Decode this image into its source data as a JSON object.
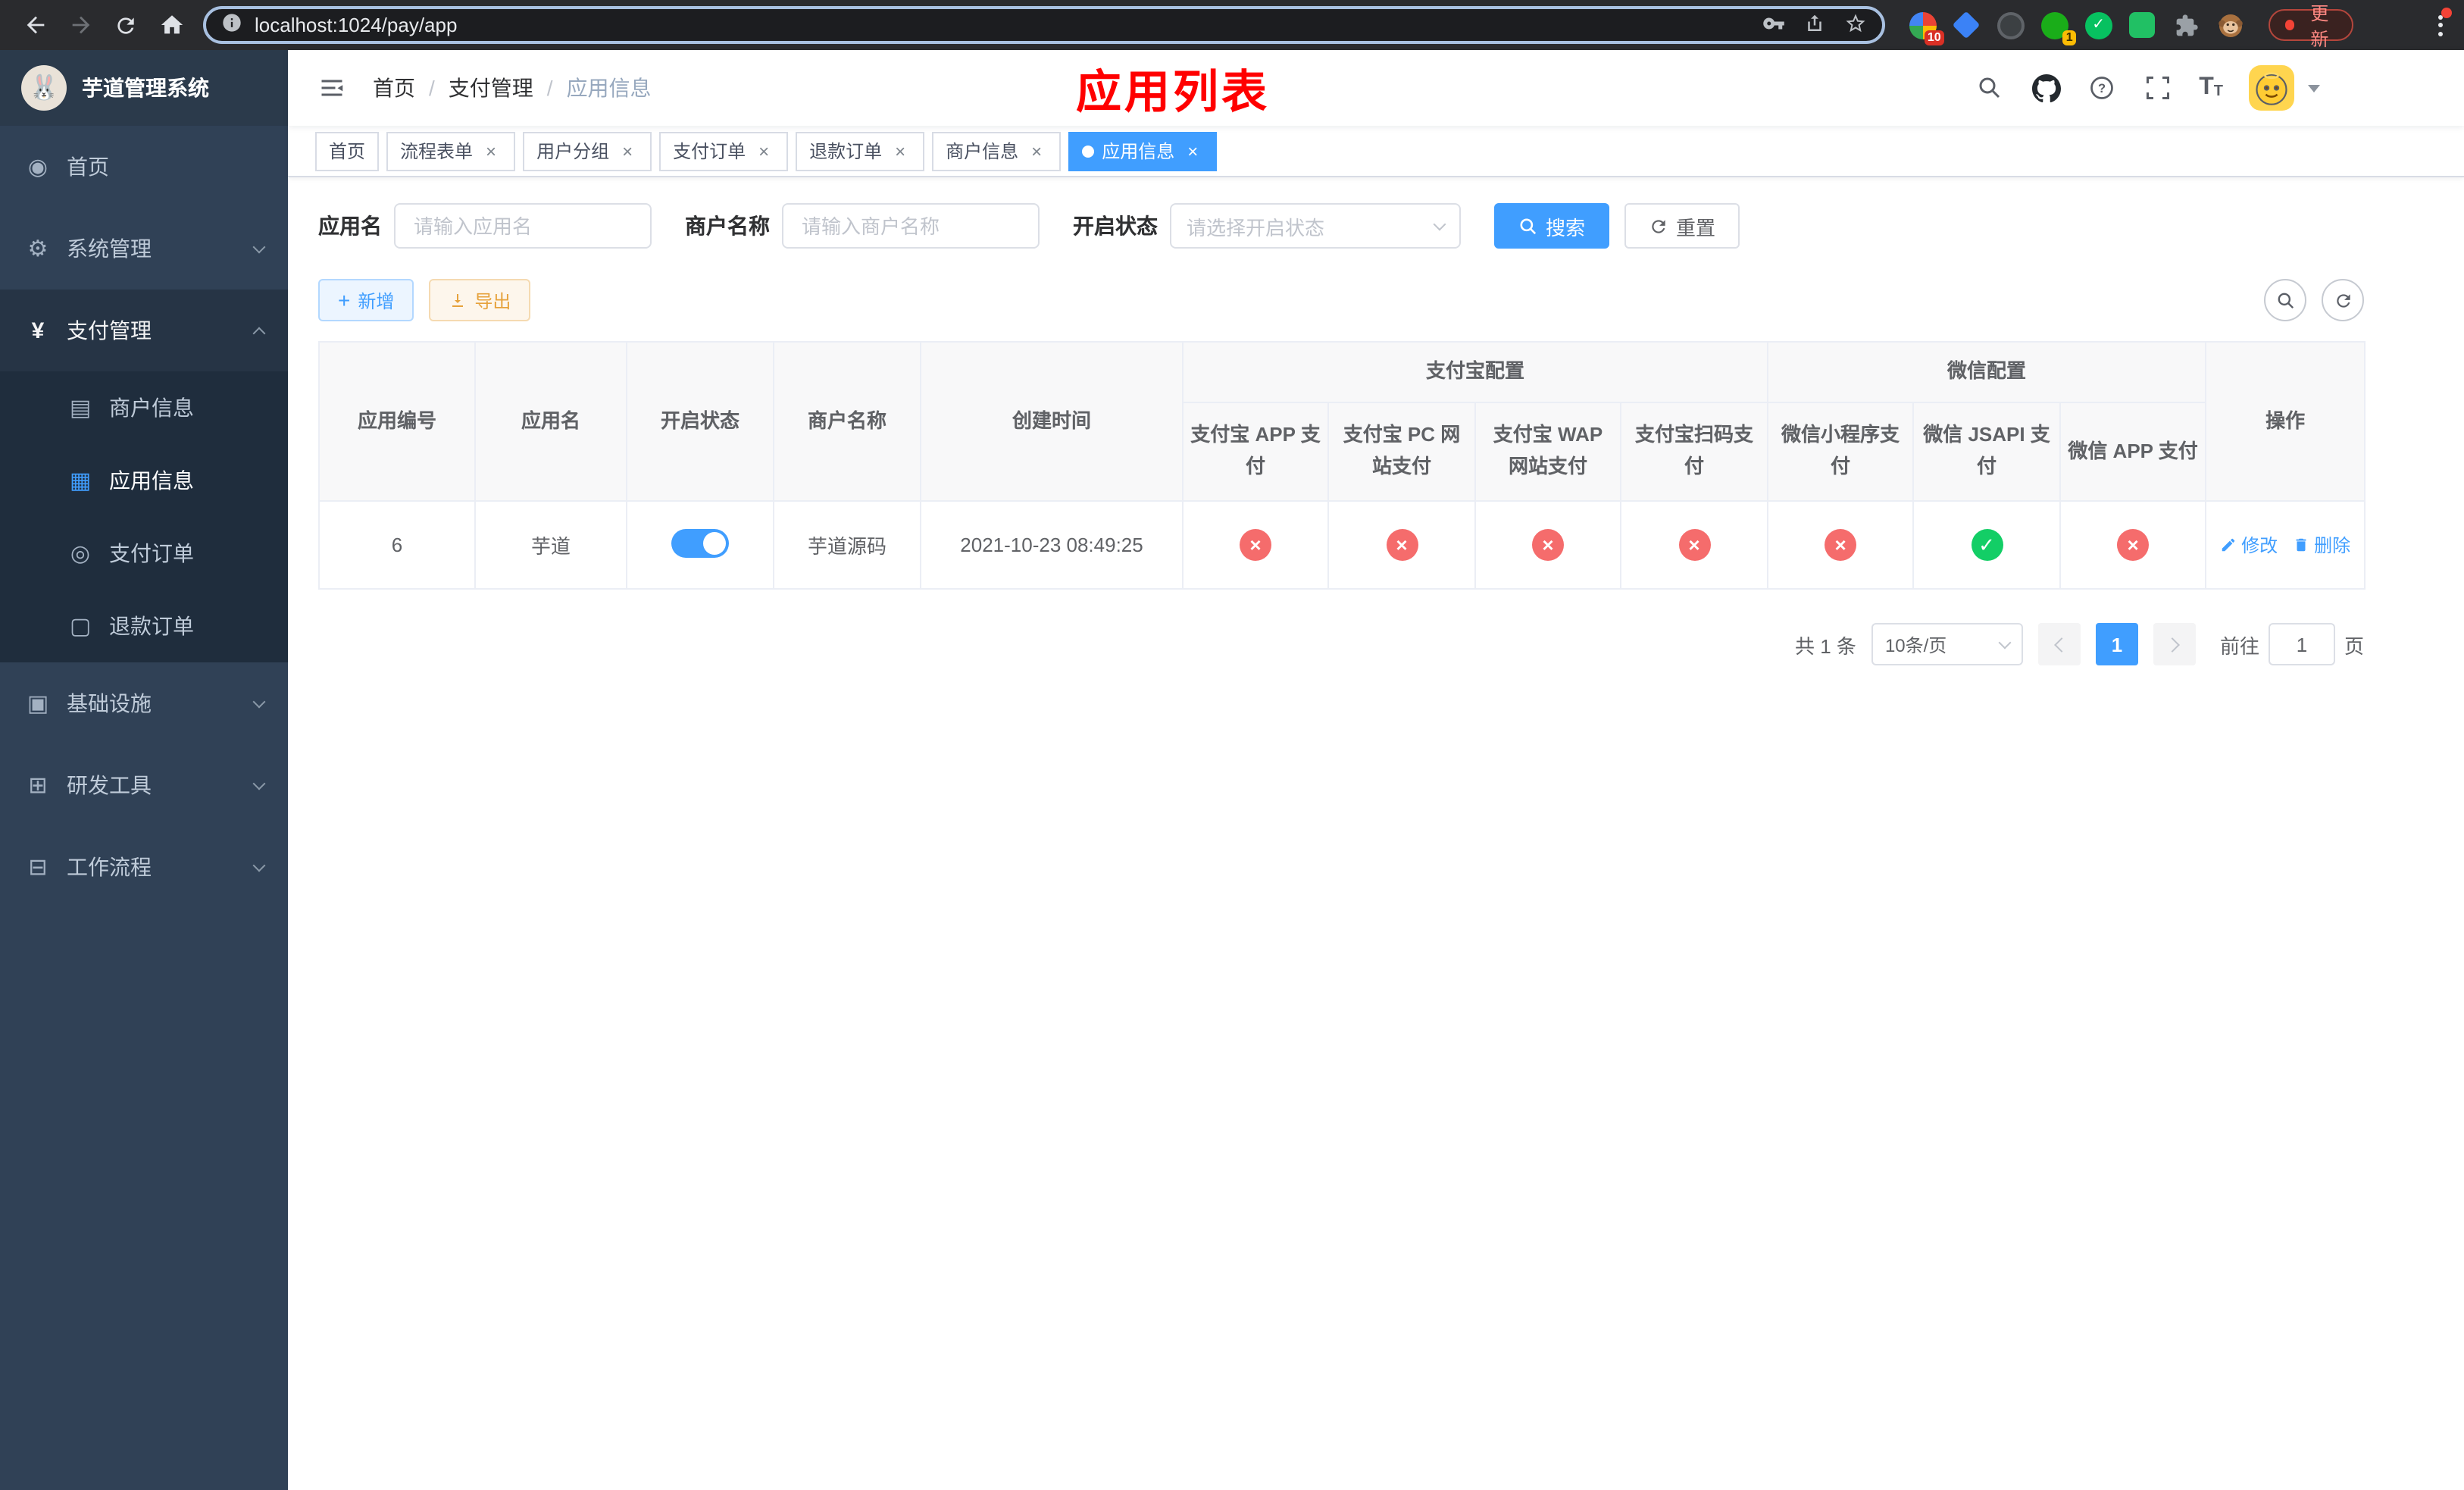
{
  "browser": {
    "url": "localhost:1024/pay/app",
    "update_label": "更新",
    "extension_badges": {
      "puzzle": "10",
      "green": "1"
    }
  },
  "sidebar": {
    "logo_title": "芋道管理系统",
    "menu": [
      {
        "label": "首页"
      },
      {
        "label": "系统管理"
      },
      {
        "label": "支付管理"
      },
      {
        "label": "商户信息"
      },
      {
        "label": "应用信息"
      },
      {
        "label": "支付订单"
      },
      {
        "label": "退款订单"
      },
      {
        "label": "基础设施"
      },
      {
        "label": "研发工具"
      },
      {
        "label": "工作流程"
      }
    ]
  },
  "header": {
    "breadcrumb": [
      "首页",
      "支付管理",
      "应用信息"
    ],
    "annotation": "应用列表"
  },
  "tabs": [
    {
      "label": "首页"
    },
    {
      "label": "流程表单"
    },
    {
      "label": "用户分组"
    },
    {
      "label": "支付订单"
    },
    {
      "label": "退款订单"
    },
    {
      "label": "商户信息"
    },
    {
      "label": "应用信息"
    }
  ],
  "filters": {
    "app_name_label": "应用名",
    "app_name_placeholder": "请输入应用名",
    "merchant_label": "商户名称",
    "merchant_placeholder": "请输入商户名称",
    "status_label": "开启状态",
    "status_placeholder": "请选择开启状态",
    "search_label": "搜索",
    "reset_label": "重置"
  },
  "toolbar": {
    "add_label": "新增",
    "export_label": "导出"
  },
  "table": {
    "groups": {
      "alipay": "支付宝配置",
      "wechat": "微信配置"
    },
    "columns": {
      "id": "应用编号",
      "name": "应用名",
      "status": "开启状态",
      "merchant": "商户名称",
      "created": "创建时间",
      "alipay_app": "支付宝 APP 支付",
      "alipay_pc": "支付宝 PC 网站支付",
      "alipay_wap": "支付宝 WAP 网站支付",
      "alipay_qr": "支付宝扫码支付",
      "wx_mini": "微信小程序支付",
      "wx_jsapi": "微信 JSAPI 支付",
      "wx_app": "微信 APP 支付",
      "actions": "操作"
    },
    "row": {
      "id": "6",
      "name": "芋道",
      "enabled": true,
      "merchant": "芋道源码",
      "created": "2021-10-23 08:49:25",
      "statuses": [
        "fail",
        "fail",
        "fail",
        "fail",
        "fail",
        "success",
        "fail"
      ],
      "edit_label": "修改",
      "delete_label": "删除"
    }
  },
  "pagination": {
    "total": "共 1 条",
    "page_size": "10条/页",
    "page": "1",
    "goto_label": "前往",
    "goto_value": "1",
    "unit_label": "页"
  },
  "colors": {
    "accent": "#409eff",
    "success": "#13ce66",
    "danger": "#f56c6c",
    "warning": "#e6a23c",
    "sidebar_bg": "#304156",
    "sidebar_sub_bg": "#1f2d3d",
    "annotation_red": "#ff0000"
  }
}
